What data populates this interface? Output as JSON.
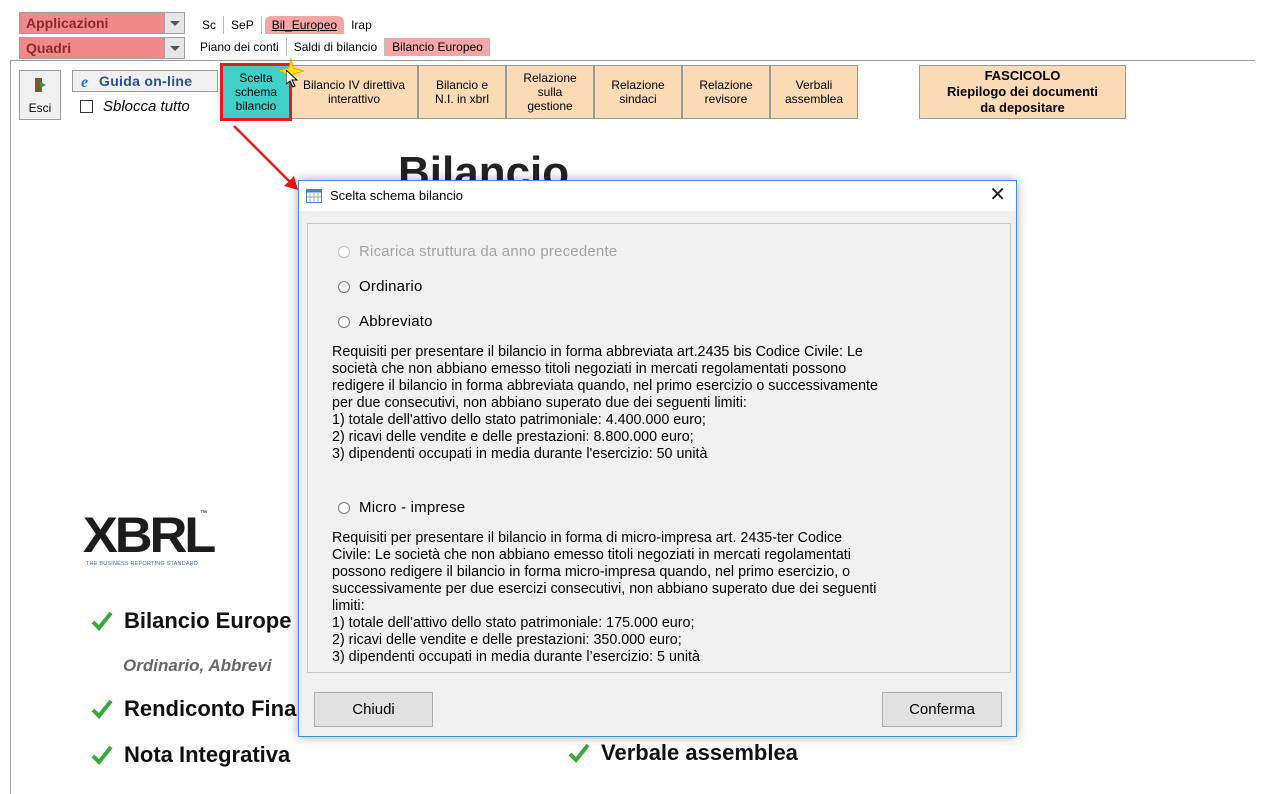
{
  "top": {
    "app_selector": "Applicazioni",
    "quadri_selector": "Quadri",
    "module_tabs": [
      "Sc",
      "SeP",
      "Bil_Europeo",
      "Irap"
    ],
    "sub_tabs": [
      "Piano dei conti",
      "Saldi di bilancio",
      "Bilancio Europeo"
    ]
  },
  "toolbar": {
    "esci": "Esci",
    "guida": "Guida on-line",
    "sblocca": "Sblocca tutto",
    "buttons": [
      "Scelta\nschema\nbilancio",
      "Bilancio IV direttiva\ninterattivo",
      "Bilancio e\nN.I. in xbrl",
      "Relazione\nsulla\ngestione",
      "Relazione\nsindaci",
      "Relazione\nrevisore",
      "Verbali\nassemblea"
    ],
    "fascicolo": "FASCICOLO\nRiepilogo dei documenti\nda depositare"
  },
  "background": {
    "title": "Bilancio",
    "logo_text": "XBRL",
    "logo_sub": "THE BUSINESS REPORTING STANDARD",
    "features": [
      "Bilancio Europe",
      "Rendiconto Fina",
      "Nota Integrativa",
      "Verbale assemblea"
    ],
    "feature_sub": "Ordinario, Abbrevi"
  },
  "dialog": {
    "title": "Scelta schema bilancio",
    "close_glyph": "✕",
    "options": {
      "ricarica": "Ricarica struttura da anno precedente",
      "ordinario": "Ordinario",
      "abbreviato": "Abbreviato",
      "micro": "Micro - imprese"
    },
    "abbreviato_text": "Requisiti per presentare il bilancio in forma abbreviata art.2435 bis Codice Civile: Le\nsocietà che non abbiano emesso titoli negoziati in mercati regolamentati possono\nredigere il bilancio in forma abbreviata quando, nel primo esercizio o successivamente\nper due consecutivi, non abbiano superato due dei seguenti limiti:\n1) totale dell'attivo dello stato patrimoniale: 4.400.000 euro;\n2) ricavi delle vendite e delle prestazioni: 8.800.000 euro;\n3) dipendenti occupati in media durante l'esercizio: 50 unità",
    "micro_text": "Requisiti per presentare il bilancio in forma di micro-impresa art. 2435-ter Codice\nCivile: Le società che non abbiano emesso titoli negoziati in mercati regolamentati\npossono redigere il bilancio in forma micro-impresa quando, nel primo esercizio, o\nsuccessivamente per due esercizi consecutivi, non abbiano superato due dei seguenti\nlimiti:\n1) totale dell’attivo dello stato patrimoniale: 175.000 euro;\n2) ricavi delle vendite e delle prestazioni: 350.000 euro;\n3) dipendenti occupati in media durante l’esercizio: 5 unità",
    "chiudi": "Chiudi",
    "conferma": "Conferma"
  },
  "colors": {
    "selector_bg": "#f08a8a",
    "toolbar_btn": "#fbdbb6",
    "highlight_btn": "#3fd0c7",
    "highlight_border": "#e8191b",
    "dialog_border": "#3b8ed8",
    "check_green": "#3aa83a"
  }
}
